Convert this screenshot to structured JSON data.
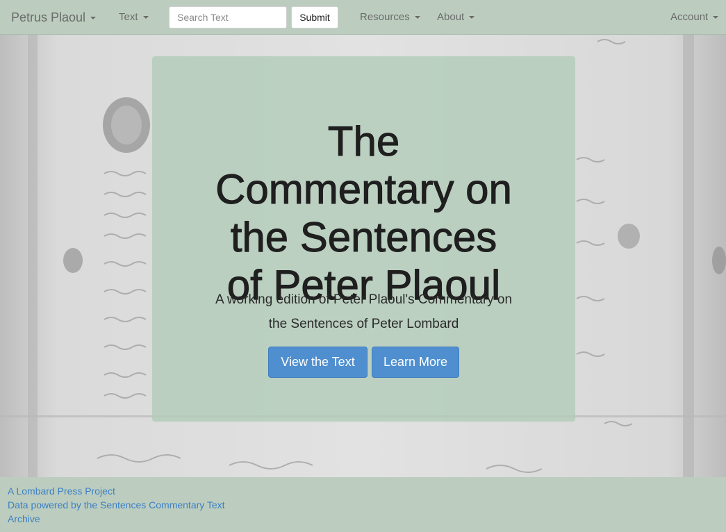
{
  "navbar": {
    "brand": "Petrus Plaoul",
    "text_menu": "Text",
    "search_placeholder": "Search Text",
    "submit_label": "Submit",
    "resources_menu": "Resources",
    "about_menu": "About",
    "account_menu": "Account"
  },
  "hero": {
    "title_lines": [
      "The",
      "Commentary on",
      "the Sentences",
      "of Peter Plaoul"
    ],
    "subtitle_lines": [
      "A working edition of Peter Plaoul's Commentary on",
      "the Sentences of Peter Lombard"
    ],
    "view_button": "View the Text",
    "learn_button": "Learn More"
  },
  "footer": {
    "links": [
      "A Lombard Press Project",
      "Data powered by the Sentences Commentary Text",
      "Archive"
    ]
  },
  "colors": {
    "navbar_bg": "#bccdbf",
    "panel_bg": "#b2ccb8",
    "button_primary": "#4f8fcf",
    "link": "#3b7fc4"
  },
  "icons": [
    "caret-down-icon"
  ]
}
